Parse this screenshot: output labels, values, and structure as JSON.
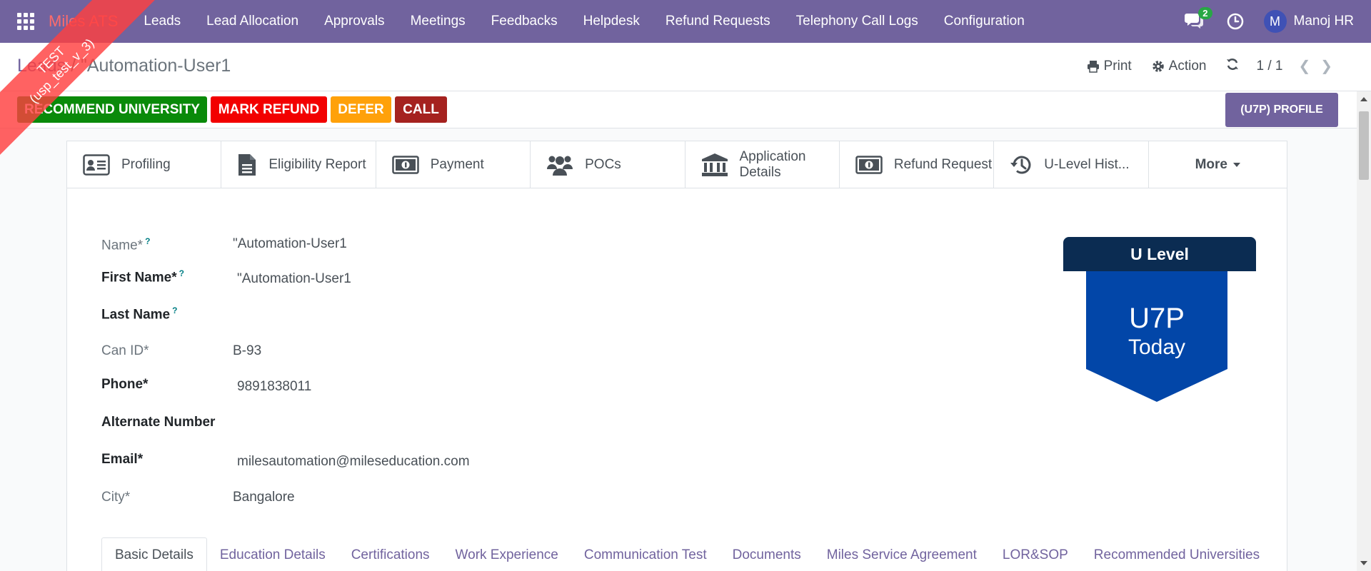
{
  "nav": {
    "brand": "Miles ATS",
    "menu": [
      "Leads",
      "Lead Allocation",
      "Approvals",
      "Meetings",
      "Feedbacks",
      "Helpdesk",
      "Refund Requests",
      "Telephony Call Logs",
      "Configuration"
    ],
    "chat_count": "2",
    "user_initial": "M",
    "user_name": "Manoj HR"
  },
  "ribbon": {
    "line1": "TEST",
    "line2": "(usp_test_v_3)"
  },
  "breadcrumb": {
    "parent": "Leads",
    "separator": " / ",
    "current": "\"Automation-User1"
  },
  "control": {
    "print_label": "Print",
    "action_label": "Action",
    "pager_value": "1 / 1"
  },
  "status_buttons": {
    "recommend": "RECOMMEND UNIVERSITY",
    "mark_refund": "MARK REFUND",
    "defer": "DEFER",
    "call": "CALL",
    "profile": "(U7P) PROFILE"
  },
  "colors": {
    "nav_bg": "#71639e",
    "recommend": "#0a8a0a",
    "mark_refund": "#f20000",
    "defer": "#ffa10a",
    "call": "#a5221f",
    "ulevel_head": "#0b2c52",
    "ulevel_body": "#0246a8"
  },
  "smart_buttons": [
    {
      "label": "Profiling",
      "icon": "id-card-icon"
    },
    {
      "label": "Eligibility Report",
      "icon": "document-icon"
    },
    {
      "label": "Payment",
      "icon": "money-icon"
    },
    {
      "label": "POCs",
      "icon": "users-icon"
    },
    {
      "label": "Application Details",
      "icon": "bank-icon"
    },
    {
      "label": "Refund Request",
      "icon": "money-icon"
    },
    {
      "label": "U-Level Hist...",
      "icon": "history-icon"
    },
    {
      "label": "More",
      "icon": "caret-down-icon"
    }
  ],
  "fields": {
    "name": {
      "label": "Name*",
      "help": "?",
      "value": "\"Automation-User1"
    },
    "first_name": {
      "label": "First Name*",
      "help": "?",
      "value": "\"Automation-User1"
    },
    "last_name": {
      "label": "Last Name",
      "help": "?",
      "value": ""
    },
    "can_id": {
      "label": "Can ID*",
      "value": "B-93"
    },
    "phone": {
      "label": "Phone*",
      "value": "9891838011"
    },
    "alternate_number": {
      "label": "Alternate Number",
      "value": ""
    },
    "email": {
      "label": "Email*",
      "value": "milesautomation@mileseducation.com"
    },
    "city": {
      "label": "City*",
      "value": "Bangalore"
    }
  },
  "ulevel": {
    "title": "U Level",
    "level": "U7P",
    "when": "Today"
  },
  "tabs": [
    "Basic Details",
    "Education Details",
    "Certifications",
    "Work Experience",
    "Communication Test",
    "Documents",
    "Miles Service Agreement",
    "LOR&SOP",
    "Recommended Universities"
  ]
}
